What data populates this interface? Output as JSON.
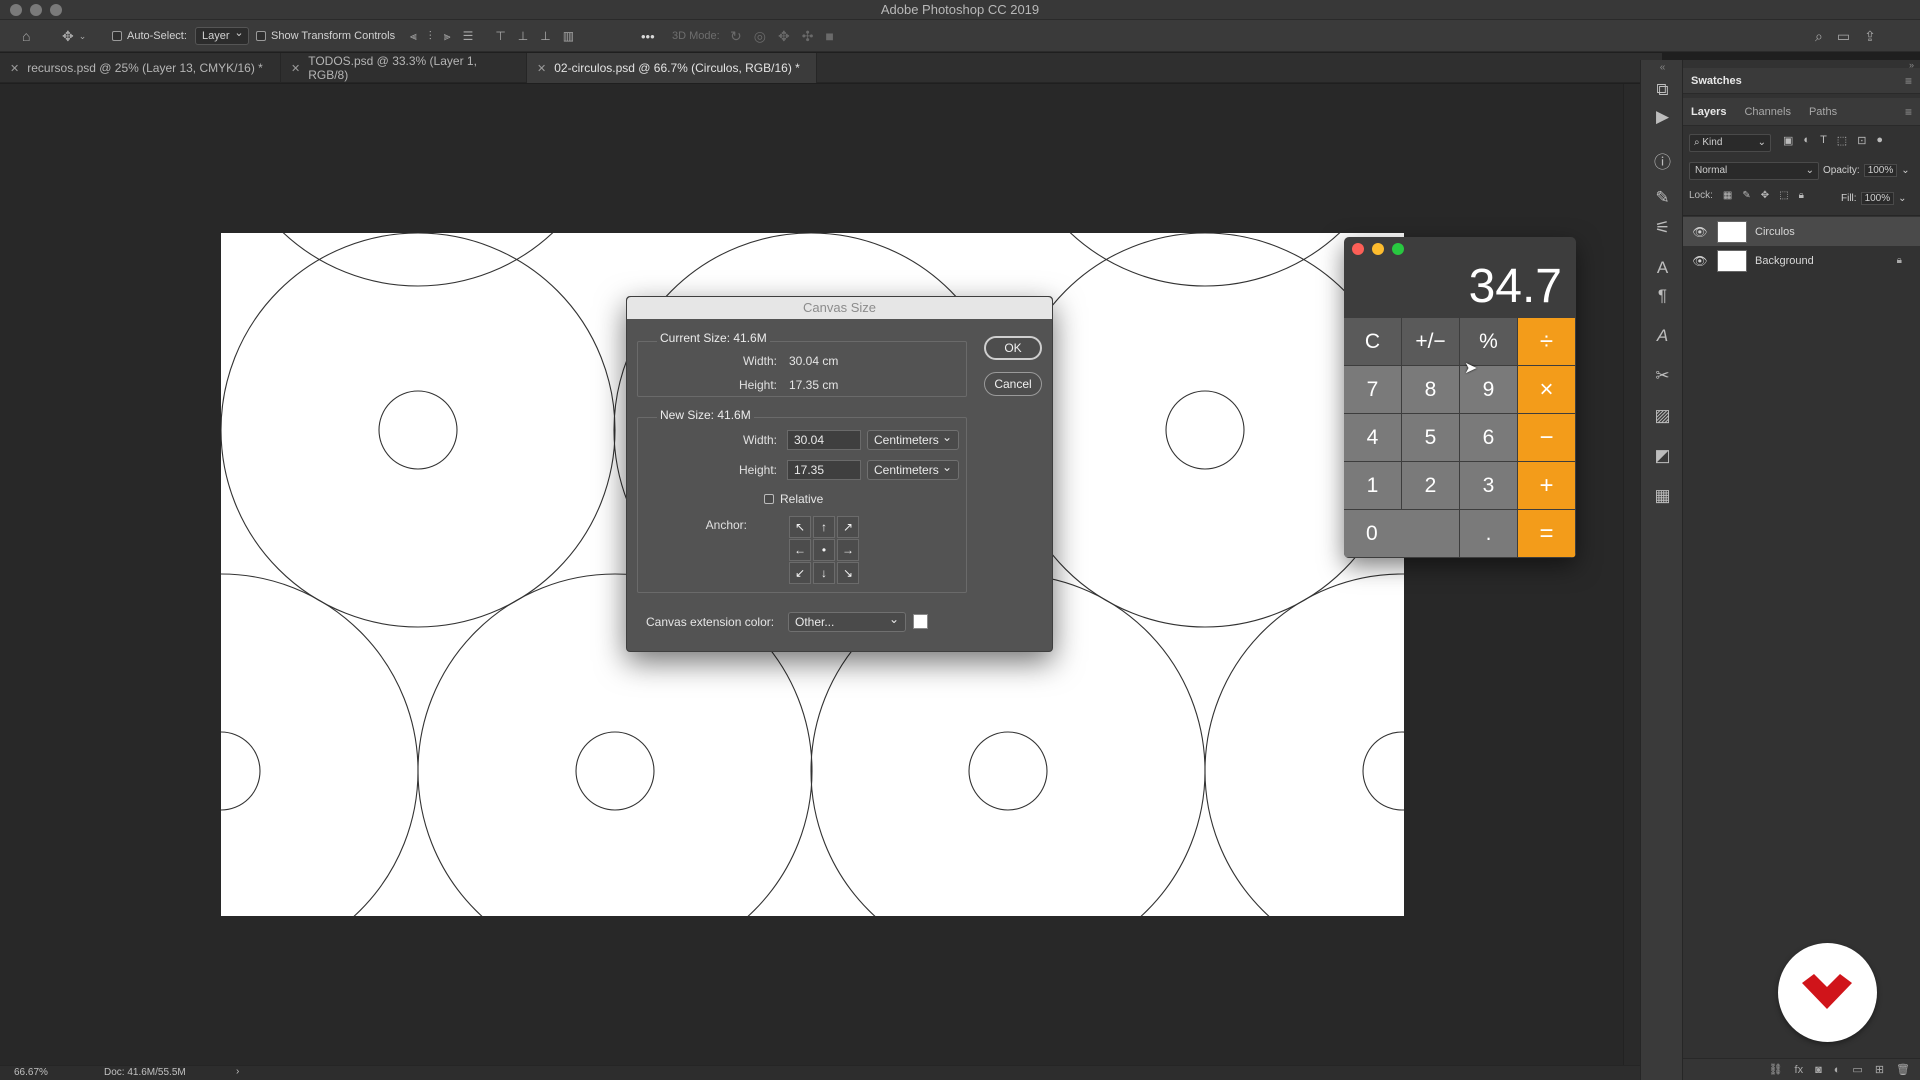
{
  "app": {
    "title": "Adobe Photoshop CC 2019"
  },
  "options_bar": {
    "auto_select_label": "Auto-Select:",
    "auto_select_target": "Layer",
    "show_transform_label": "Show Transform Controls",
    "mode_3d_label": "3D Mode:",
    "more": "•••"
  },
  "doc_tabs": [
    {
      "label": "recursos.psd @ 25% (Layer 13, CMYK/16) *",
      "active": false
    },
    {
      "label": "TODOS.psd @ 33.3% (Layer 1, RGB/8)",
      "active": false
    },
    {
      "label": "02-circulos.psd @ 66.7% (Circulos, RGB/16) *",
      "active": true
    }
  ],
  "status": {
    "zoom": "66.67%",
    "doc": "Doc: 41.6M/55.5M",
    "arrow": "›"
  },
  "panels": {
    "swatches_tab": "Swatches",
    "tabs": [
      "Layers",
      "Channels",
      "Paths"
    ],
    "filter_kind": "Kind",
    "blend_mode": "Normal",
    "opacity_label": "Opacity:",
    "opacity_value": "100%",
    "lock_label": "Lock:",
    "fill_label": "Fill:",
    "fill_value": "100%",
    "layers": [
      {
        "name": "Circulos",
        "visible": true,
        "locked": false
      },
      {
        "name": "Background",
        "visible": true,
        "locked": true
      }
    ]
  },
  "dialog": {
    "title": "Canvas Size",
    "current_size_label": "Current Size: 41.6M",
    "current_width_label": "Width:",
    "current_width_value": "30.04 cm",
    "current_height_label": "Height:",
    "current_height_value": "17.35 cm",
    "new_size_label": "New Size: 41.6M",
    "new_width_label": "Width:",
    "new_width_value": "30.04",
    "new_width_unit": "Centimeters",
    "new_height_label": "Height:",
    "new_height_value": "17.35",
    "new_height_unit": "Centimeters",
    "relative_label": "Relative",
    "anchor_label": "Anchor:",
    "anchor_arrows": [
      "↖",
      "↑",
      "↗",
      "←",
      "•",
      "→",
      "↙",
      "↓",
      "↘"
    ],
    "extension_color_label": "Canvas extension color:",
    "extension_color_value": "Other...",
    "ok_label": "OK",
    "cancel_label": "Cancel"
  },
  "calculator": {
    "display": "34.7",
    "keys": [
      {
        "label": "C",
        "kind": "fn"
      },
      {
        "label": "+/−",
        "kind": "fn"
      },
      {
        "label": "%",
        "kind": "fn"
      },
      {
        "label": "÷",
        "kind": "op"
      },
      {
        "label": "7",
        "kind": "num"
      },
      {
        "label": "8",
        "kind": "num"
      },
      {
        "label": "9",
        "kind": "num"
      },
      {
        "label": "×",
        "kind": "op"
      },
      {
        "label": "4",
        "kind": "num"
      },
      {
        "label": "5",
        "kind": "num"
      },
      {
        "label": "6",
        "kind": "num"
      },
      {
        "label": "−",
        "kind": "op"
      },
      {
        "label": "1",
        "kind": "num"
      },
      {
        "label": "2",
        "kind": "num"
      },
      {
        "label": "3",
        "kind": "num"
      },
      {
        "label": "+",
        "kind": "op"
      },
      {
        "label": "0",
        "kind": "num",
        "wide": true
      },
      {
        "label": ".",
        "kind": "num"
      },
      {
        "label": "=",
        "kind": "op"
      }
    ]
  },
  "colors": {
    "accent_orange": "#f39c1a",
    "logo_red": "#d0141a"
  }
}
